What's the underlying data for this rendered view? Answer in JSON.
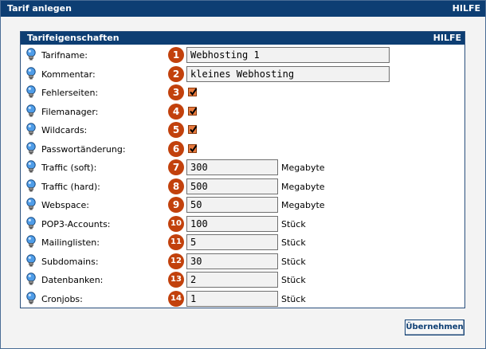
{
  "window": {
    "title": "Tarif anlegen",
    "help": "HILFE"
  },
  "panel": {
    "title": "Tarifeigenschaften",
    "help": "HILFE"
  },
  "fields": [
    {
      "label": "Tarifname:",
      "number": "1",
      "kind": "text",
      "value": "Webhosting 1",
      "unit": ""
    },
    {
      "label": "Kommentar:",
      "number": "2",
      "kind": "text",
      "value": "kleines Webhosting",
      "unit": ""
    },
    {
      "label": "Fehlerseiten:",
      "number": "3",
      "kind": "checkbox",
      "checked": true
    },
    {
      "label": "Filemanager:",
      "number": "4",
      "kind": "checkbox",
      "checked": true
    },
    {
      "label": "Wildcards:",
      "number": "5",
      "kind": "checkbox",
      "checked": true
    },
    {
      "label": "Passwortänderung:",
      "number": "6",
      "kind": "checkbox",
      "checked": true
    },
    {
      "label": "Traffic (soft):",
      "number": "7",
      "kind": "short",
      "value": "300",
      "unit": "Megabyte"
    },
    {
      "label": "Traffic (hard):",
      "number": "8",
      "kind": "short",
      "value": "500",
      "unit": "Megabyte"
    },
    {
      "label": "Webspace:",
      "number": "9",
      "kind": "short",
      "value": "50",
      "unit": "Megabyte"
    },
    {
      "label": "POP3-Accounts:",
      "number": "10",
      "kind": "short",
      "value": "100",
      "unit": "Stück"
    },
    {
      "label": "Mailinglisten:",
      "number": "11",
      "kind": "short",
      "value": "5",
      "unit": "Stück"
    },
    {
      "label": "Subdomains:",
      "number": "12",
      "kind": "short",
      "value": "30",
      "unit": "Stück"
    },
    {
      "label": "Datenbanken:",
      "number": "13",
      "kind": "short",
      "value": "2",
      "unit": "Stück"
    },
    {
      "label": "Cronjobs:",
      "number": "14",
      "kind": "short",
      "value": "1",
      "unit": "Stück"
    }
  ],
  "actions": {
    "submit_label": "Übernehmen"
  },
  "colors": {
    "titlebar": "#0d3e73",
    "number_badge": "#c2410c",
    "checkbox": "#e87a3e"
  },
  "icons": {
    "row_icon": "lightbulb-icon"
  }
}
